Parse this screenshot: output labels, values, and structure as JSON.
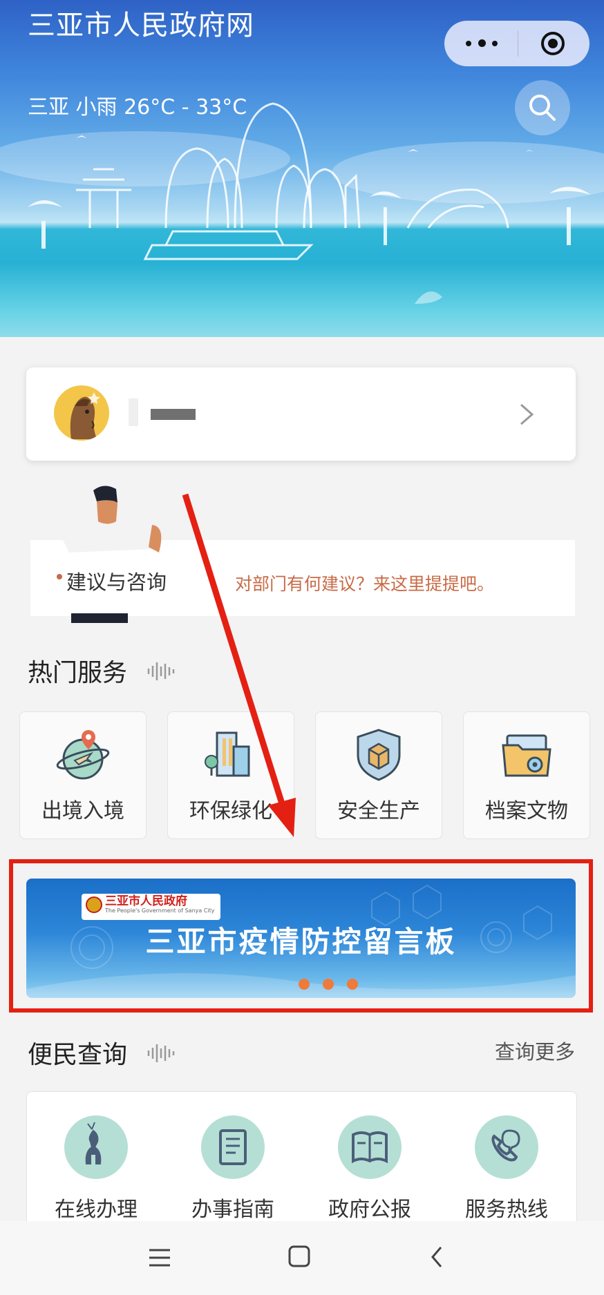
{
  "header": {
    "app_title": "三亚市人民政府网",
    "weather": "三亚 小雨 26°C - 33°C"
  },
  "icons": {
    "capsule_menu": "more-dots-icon",
    "capsule_close": "target-close-icon",
    "search": "search-icon",
    "user_chevron": "chevron-right-icon"
  },
  "consult": {
    "title": "建议与咨询",
    "subtitle": "对部门有何建议？来这里提提吧。"
  },
  "hot_services": {
    "title": "热门服务",
    "items": [
      {
        "label": "出境入境",
        "icon": "globe-plane-icon"
      },
      {
        "label": "环保绿化",
        "icon": "buildings-tree-icon"
      },
      {
        "label": "安全生产",
        "icon": "shield-box-icon"
      },
      {
        "label": "档案文物",
        "icon": "folder-gear-icon"
      }
    ]
  },
  "banner": {
    "org_name": "三亚市人民政府",
    "org_en": "The People's Government of Sanya City",
    "title": "三亚市疫情防控留言板",
    "slide_count": 3
  },
  "query": {
    "title": "便民查询",
    "more_label": "查询更多",
    "items": [
      {
        "label": "在线办理",
        "icon": "deer-icon"
      },
      {
        "label": "办事指南",
        "icon": "notebook-icon"
      },
      {
        "label": "政府公报",
        "icon": "newspaper-icon"
      },
      {
        "label": "服务热线",
        "icon": "phone-chat-icon"
      }
    ]
  },
  "nav": {
    "menu": "menu-icon",
    "home": "home-square-icon",
    "back": "back-chevron-icon"
  },
  "colors": {
    "highlight_frame": "#e42013",
    "annotation_arrow": "#e42013",
    "banner_dots": "#f07a3a",
    "query_icon_bg": "#b5dfd4"
  }
}
